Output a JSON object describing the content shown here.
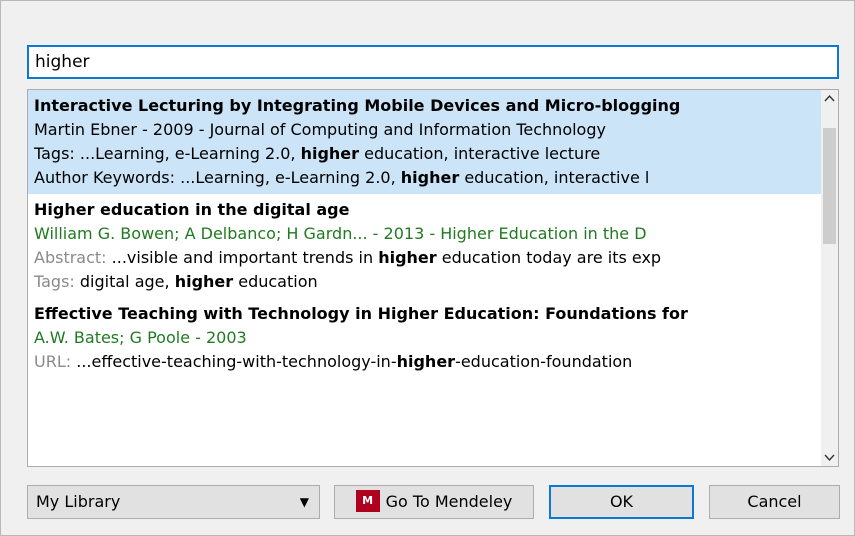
{
  "search": {
    "value": "higher"
  },
  "results": [
    {
      "selected": true,
      "title": "Interactive Lecturing by Integrating Mobile Devices and Micro-blogging",
      "meta": "Martin Ebner - 2009 - Journal of Computing and Information Technology",
      "tags_prefix": "Tags: ...Learning, e-Learning 2.0, ",
      "tags_hl": "higher",
      "tags_suffix": " education, interactive lecture",
      "kw_prefix": "Author Keywords: ...Learning, e-Learning 2.0, ",
      "kw_hl": "higher",
      "kw_suffix": " education, interactive l"
    },
    {
      "selected": false,
      "title": "Higher education in the digital age",
      "meta": "William G. Bowen; A Delbanco; H Gardn... - 2013 - Higher Education in the D",
      "abstract_label": "Abstract:",
      "abstract_prefix": " ...visible and important trends in ",
      "abstract_hl": "higher",
      "abstract_suffix": " education today are its exp",
      "tags_label": "Tags:",
      "tags_prefix": " digital age, ",
      "tags_hl": "higher",
      "tags_suffix": " education"
    },
    {
      "selected": false,
      "title": "Effective Teaching with Technology in Higher Education: Foundations for",
      "meta": "A.W. Bates; G Poole - 2003",
      "url_label": "URL:",
      "url_prefix": " ...effective-teaching-with-technology-in-",
      "url_hl": "higher",
      "url_suffix": "-education-foundation"
    }
  ],
  "scrollbar": {
    "up": "^",
    "down": "v"
  },
  "footer": {
    "library_label": "My Library",
    "library_arrow": "▼",
    "mendeley_logo": "M",
    "mendeley_label": "Go To Mendeley",
    "ok_label": "OK",
    "cancel_label": "Cancel"
  },
  "colors": {
    "accent": "#0a78d4",
    "selection": "#cce4f7",
    "meta_green": "#217a21",
    "mendeley_red": "#b00020"
  },
  "icons": {
    "scroll_up": "chevron-up-icon",
    "scroll_down": "chevron-down-icon",
    "dropdown": "caret-down-icon",
    "mendeley": "mendeley-logo-icon"
  }
}
